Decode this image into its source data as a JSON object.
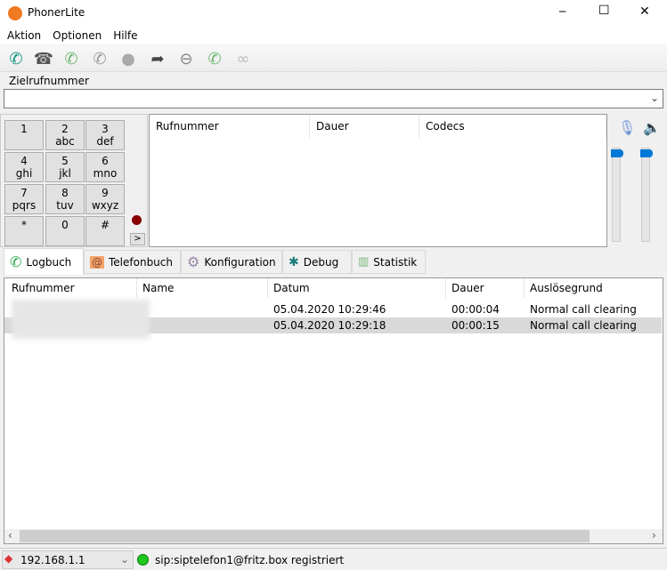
{
  "window": {
    "title": "PhonerLite",
    "minimize": "─",
    "maximize": "☐",
    "close": "✕"
  },
  "menu": [
    "Aktion",
    "Optionen",
    "Hilfe"
  ],
  "toolbar": [
    "call-icon",
    "hangup-icon",
    "callback-icon",
    "hold-icon",
    "conference-icon",
    "forward-icon",
    "reject-icon",
    "waiting-call-icon",
    "anonymous-icon"
  ],
  "dial": {
    "label": "Zielrufnummer",
    "value": ""
  },
  "keypad": [
    [
      "1",
      ""
    ],
    [
      "2",
      "abc"
    ],
    [
      "3",
      "def"
    ],
    [
      "4",
      "ghi"
    ],
    [
      "5",
      "jkl"
    ],
    [
      "6",
      "mno"
    ],
    [
      "7",
      "pqrs"
    ],
    [
      "8",
      "tuv"
    ],
    [
      "9",
      "wxyz"
    ],
    [
      "*",
      ""
    ],
    [
      "0",
      ""
    ],
    [
      "#",
      ""
    ]
  ],
  "keypad_more": ">",
  "calls": {
    "columns": [
      "Rufnummer",
      "Dauer",
      "Codecs"
    ]
  },
  "tabs": [
    "Logbuch",
    "Telefonbuch",
    "Konfiguration",
    "Debug",
    "Statistik"
  ],
  "log": {
    "columns": [
      "Rufnummer",
      "Name",
      "Datum",
      "Dauer",
      "Auslösegrund"
    ],
    "rows": [
      {
        "name": "",
        "datum": "05.04.2020 10:29:46",
        "dauer": "00:00:04",
        "grund": "Normal call clearing"
      },
      {
        "name": "",
        "datum": "05.04.2020 10:29:18",
        "dauer": "00:00:15",
        "grund": "Normal call clearing"
      }
    ]
  },
  "status": {
    "ip": "192.168.1.1",
    "registration": "sip:siptelefon1@fritz.box registriert"
  },
  "colors": {
    "accent": "#0078d7",
    "green": "#2aa84a"
  }
}
